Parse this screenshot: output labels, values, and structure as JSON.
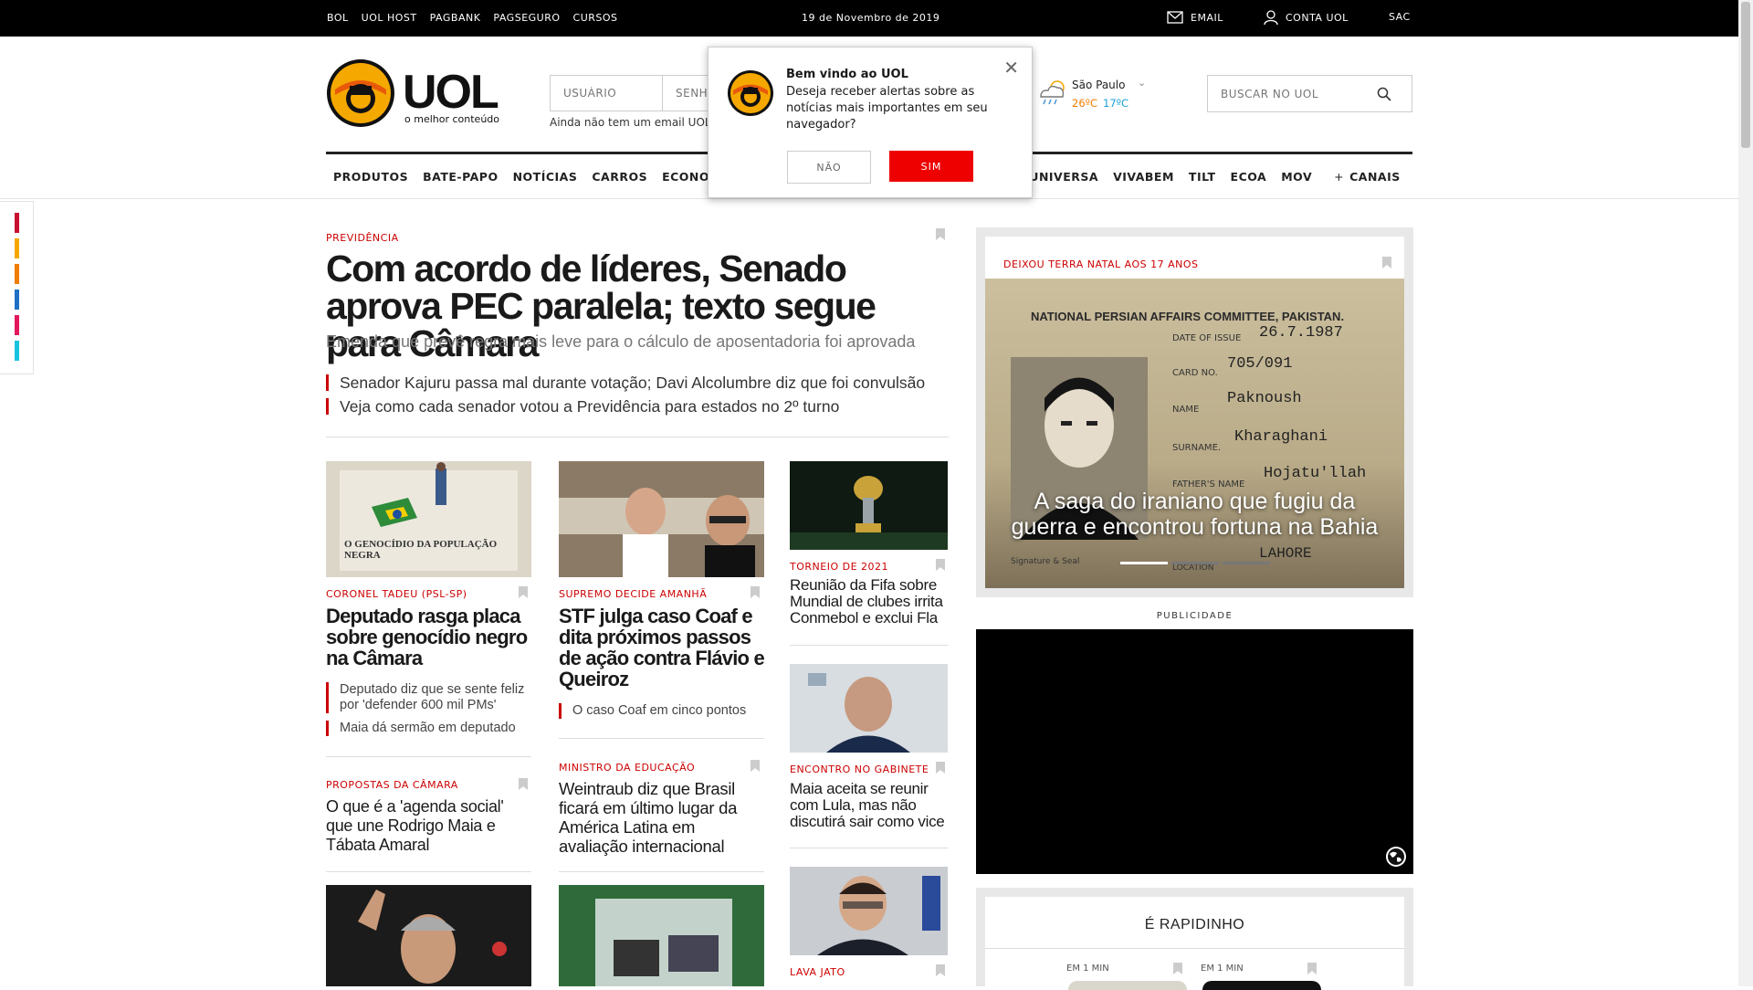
{
  "topbar": {
    "links": [
      "BOL",
      "UOL HOST",
      "PAGBANK",
      "PAGSEGURO",
      "CURSOS"
    ],
    "date": "19 de Novembro de 2019",
    "email": "EMAIL",
    "account": "CONTA UOL",
    "sac": "SAC"
  },
  "header": {
    "logo_text": "UOL",
    "logo_tagline": "o melhor conteúdo",
    "user_placeholder": "USUÁRIO",
    "pass_placeholder": "SENHA",
    "signup_hint": "Ainda não tem um email UOL",
    "weather": {
      "city": "São Paulo",
      "max": "26ºC",
      "min": "17ºC"
    },
    "search_placeholder": "BUSCAR NO UOL"
  },
  "nav": {
    "items": [
      "PRODUTOS",
      "BATE-PAPO",
      "NOTÍCIAS",
      "CARROS",
      "ECONOMIA",
      "UNIVERSA",
      "VIVABEM",
      "TILT",
      "ECOA",
      "MOV"
    ],
    "more": "CANAIS"
  },
  "popup": {
    "title": "Bem vindo ao UOL",
    "text": "Deseja receber alertas sobre as notícias mais importantes em seu navegador?",
    "no": "NÃO",
    "yes": "SIM"
  },
  "sidebar_colors": [
    "#c8102e",
    "#f5a800",
    "#f07c00",
    "#1f6fc5",
    "#e2185b",
    "#18c3e0"
  ],
  "main": {
    "kicker": "PREVIDÊNCIA",
    "headline": "Com acordo de líderes, Senado aprova PEC paralela; texto segue para Câmara",
    "subline": "Emenda que prevê regra mais leve para o cálculo de aposentadoria foi aprovada",
    "related": [
      "Senador Kajuru passa mal durante votação; Davi Alcolumbre diz que foi convulsão",
      "Veja como cada senador votou a Previdência para estados no 2º turno"
    ]
  },
  "col1": {
    "img_caption": "O GENOCÍDIO DA POPULAÇÃO NEGRA",
    "kicker": "CORONEL TADEU (PSL-SP)",
    "title": "Deputado rasga placa sobre genocídio negro na Câmara",
    "bullets": [
      "Deputado diz que se sente feliz por 'defender 600 mil PMs'",
      "Maia dá sermão em deputado"
    ],
    "kicker2": "PROPOSTAS DA CÂMARA",
    "title2": "O que é a 'agenda social' que une Rodrigo Maia e Tábata Amaral"
  },
  "col2": {
    "kicker": "SUPREMO DECIDE AMANHÃ",
    "title": "STF julga caso Coaf e dita próximos passos de ação contra Flávio e Queiroz",
    "bullets": [
      "O caso Coaf em cinco pontos"
    ],
    "kicker2": "MINISTRO DA EDUCAÇÃO",
    "title2": "Weintraub diz que Brasil ficará em último lugar da América Latina em avaliação internacional"
  },
  "col3": {
    "kicker": "TORNEIO DE 2021",
    "title": "Reunião da Fifa sobre Mundial de clubes irrita Conmebol e exclui Fla",
    "kicker2": "ENCONTRO NO GABINETE",
    "title2": "Maia aceita se reunir com Lula, mas não discutirá sair como vice",
    "kicker3": "LAVA JATO"
  },
  "feature": {
    "kicker": "DEIXOU TERRA NATAL AOS 17 ANOS",
    "title": "A saga do iraniano que fugiu da guerra e encontrou fortuna na Bahia",
    "doc_header": "NATIONAL PERSIAN AFFAIRS COMMITTEE, PAKISTAN.",
    "doc_date_label": "DATE OF ISSUE",
    "doc_date": "26.7.1987",
    "doc_card_label": "CARD NO.",
    "doc_card": "705/091",
    "doc_name_label": "NAME",
    "doc_name": "Paknoush",
    "doc_surname_label": "SURNAME.",
    "doc_surname": "Kharaghani",
    "doc_father_label": "FATHER'S NAME",
    "doc_father": "Hojatu'llah",
    "doc_place": "LAHORE",
    "doc_sig": "Signature & Seal",
    "doc_loc": "LOCATION"
  },
  "ad_label": "PUBLICIDADE",
  "rapidinho": {
    "title": "É RAPIDINHO",
    "items": [
      "EM 1 MIN",
      "EM 1 MIN"
    ]
  }
}
